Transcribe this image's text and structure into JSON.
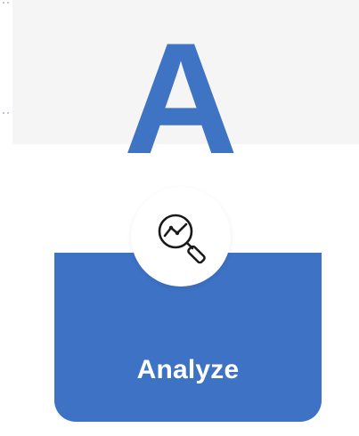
{
  "hero": {
    "letter": "A",
    "letter_color": "#3f73c4"
  },
  "card": {
    "label": "Analyze",
    "background_color": "#3d72c5",
    "icon": "magnifier-chart-icon"
  },
  "top_panel_color": "#f5f5f5"
}
